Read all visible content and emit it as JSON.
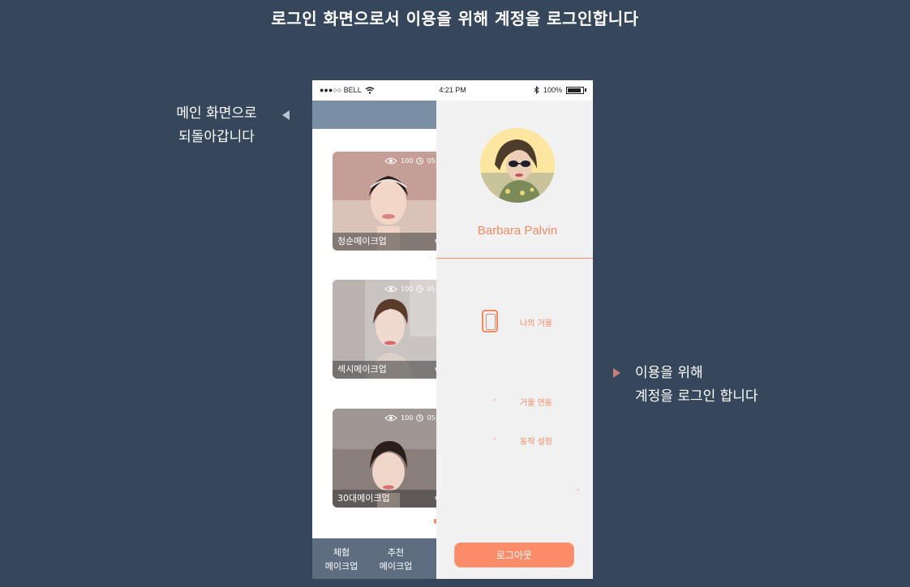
{
  "heading": "로그인 화면으로서 이용을 위해 계정을 로그인합니다",
  "notes": {
    "left": [
      "메인 화면으로",
      "되돌아갑니다"
    ],
    "right": [
      "이용을 위해",
      "계정을 로그인 합니다"
    ]
  },
  "status_bar": {
    "carrier": "●●●○○ BELL",
    "time": "4:21 PM",
    "battery": "100%"
  },
  "cards": [
    {
      "label": "청순메이크업",
      "views": "100",
      "time": "05분"
    },
    {
      "label": "섹시메이크업",
      "views": "100",
      "time": "05분"
    },
    {
      "label": "30대메이크업",
      "views": "100",
      "time": "05분"
    }
  ],
  "tabs": [
    [
      "체험",
      "메이크업"
    ],
    [
      "추천",
      "메이크업"
    ]
  ],
  "drawer": {
    "user_name": "Barbara Palvin",
    "menu": {
      "mirror": "나의 거울",
      "mirror_link": "거울 연동",
      "motion_setting": "동작 설정"
    },
    "logout": "로그아웃"
  },
  "colors": {
    "background": "#36465b",
    "accent": "#ef8a63",
    "header": "#7a8fa6",
    "tabbar": "#5e6e80"
  }
}
